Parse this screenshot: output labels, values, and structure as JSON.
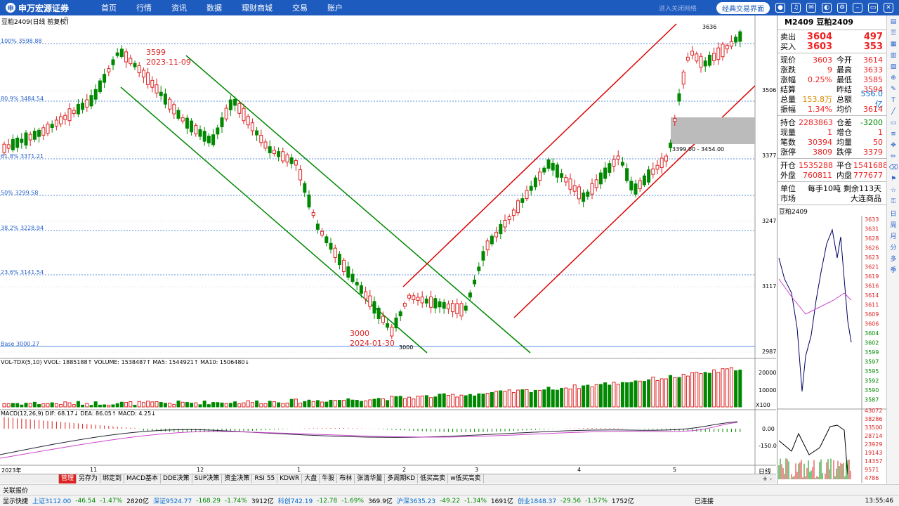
{
  "app": {
    "brand": "申万宏源证券",
    "classic_btn": "经典交易界面",
    "hint": "进入关闭网络"
  },
  "nav": [
    "首页",
    "行情",
    "资讯",
    "数据",
    "理财商城",
    "交易",
    "账户"
  ],
  "chart": {
    "title": "豆粕2409(日线 前复权)",
    "fib": [
      "100% 3598.88",
      "80.9% 3484.54",
      "61.8% 3371.21",
      "50% 3299.58",
      "38.2% 3228.94",
      "23.6% 3141.54",
      "Base 3000.27"
    ],
    "price_labels": [
      "3506",
      "3377",
      "3247",
      "3117",
      "2987"
    ],
    "high_label": "3599",
    "high_date": "2023-11-09",
    "low_label": "3000",
    "low_date": "2024-01-30",
    "low_tick": "3000",
    "top_tick": "3636",
    "gap_label": "3399.00 - 3454.00",
    "x_labels": [
      "2023年",
      "11",
      "12",
      "1",
      "2",
      "3",
      "4",
      "5"
    ],
    "x_unit": "日线"
  },
  "vol": {
    "header": "VOL-TDX(5,10) VVOL: 1885188↑ VOLUME: 1538487↑ MA5: 1544921↑ MA10: 1506480↓",
    "axis": [
      "20000",
      "10000"
    ],
    "unit": "X100"
  },
  "macd": {
    "header": "MACD(12,26,9) DIF: 68.17↓ DEA: 86.05↑ MACD: 4.25↓",
    "axis": [
      "0.00",
      "-150.0"
    ]
  },
  "quote": {
    "code": "M2409",
    "name": "豆粕2409",
    "sell_label": "卖出",
    "sell_price": "3604",
    "sell_vol": "497",
    "buy_label": "买入",
    "buy_price": "3603",
    "buy_vol": "353",
    "rows1": [
      [
        "现价",
        "3603",
        "今开",
        "3614"
      ],
      [
        "涨跌",
        "9",
        "最高",
        "3633"
      ],
      [
        "涨幅",
        "0.25%",
        "最低",
        "3585"
      ],
      [
        "结算",
        "",
        "昨结",
        "3594"
      ],
      [
        "总量",
        "153.8万",
        "总额",
        "556.0亿"
      ],
      [
        "振幅",
        "1.34%",
        "均价",
        "3614"
      ]
    ],
    "rows2": [
      [
        "持仓",
        "2283863",
        "仓差",
        "-3200"
      ],
      [
        "现量",
        "1",
        "增仓",
        "1"
      ],
      [
        "笔数",
        "30394",
        "均量",
        "50"
      ],
      [
        "涨停",
        "3809",
        "跌停",
        "3379"
      ]
    ],
    "rows3": [
      [
        "开仓",
        "1535288",
        "平仓",
        "1541688"
      ],
      [
        "外盘",
        "760811",
        "内盘",
        "777677"
      ]
    ],
    "unit_label": "单位",
    "unit_value": "每手10吨",
    "remain": "剩余113天",
    "market_label": "市场",
    "market_value": "大连商品",
    "mini_title": "豆粕2409",
    "mini_prices": [
      "3633",
      "3631",
      "3628",
      "3626",
      "3623",
      "3621",
      "3619",
      "3616",
      "3614",
      "3611",
      "3609",
      "3606",
      "3604",
      "3602",
      "3599",
      "3597",
      "3595",
      "3592",
      "3590",
      "3587"
    ],
    "mini_vol": [
      "43072",
      "38286",
      "33500",
      "28714",
      "23929",
      "19143",
      "14357",
      "9571",
      "4786"
    ]
  },
  "bottom_tabs": [
    "管理",
    "另存为",
    "绑定到",
    "MACD基本",
    "DDE决策",
    "SUP决策",
    "资金决策",
    "RSI 55",
    "KDWR",
    "大盘",
    "牛股",
    "布林",
    "张清华量",
    "多周期KD",
    "低买高卖",
    "w低买高卖"
  ],
  "mini_tabs": [
    "笔",
    "价",
    "细",
    "势",
    "联",
    "值",
    "主",
    "筹"
  ],
  "status1": "关联报价",
  "status2": {
    "label": "显示快捷",
    "sh": "上证3112.00",
    "sh_chg": "-46.54",
    "sh_pct": "-1.47%",
    "sh_amt": "2820亿",
    "sz": "深证9524.77",
    "sz_chg": "-168.29",
    "sz_pct": "-1.74%",
    "sz_amt": "3912亿",
    "kc": "科创742.19",
    "kc_chg": "-12.78",
    "kc_pct": "-1.69%",
    "kc_amt": "369.9亿",
    "hs": "沪深3635.23",
    "hs_chg": "-49.22",
    "hs_pct": "-1.34%",
    "hs_amt": "1691亿",
    "cy": "创业1848.37",
    "cy_chg": "-29.56",
    "cy_pct": "-1.57%",
    "cy_amt": "1752亿",
    "conn": "已连接",
    "time": "13:55:46"
  }
}
